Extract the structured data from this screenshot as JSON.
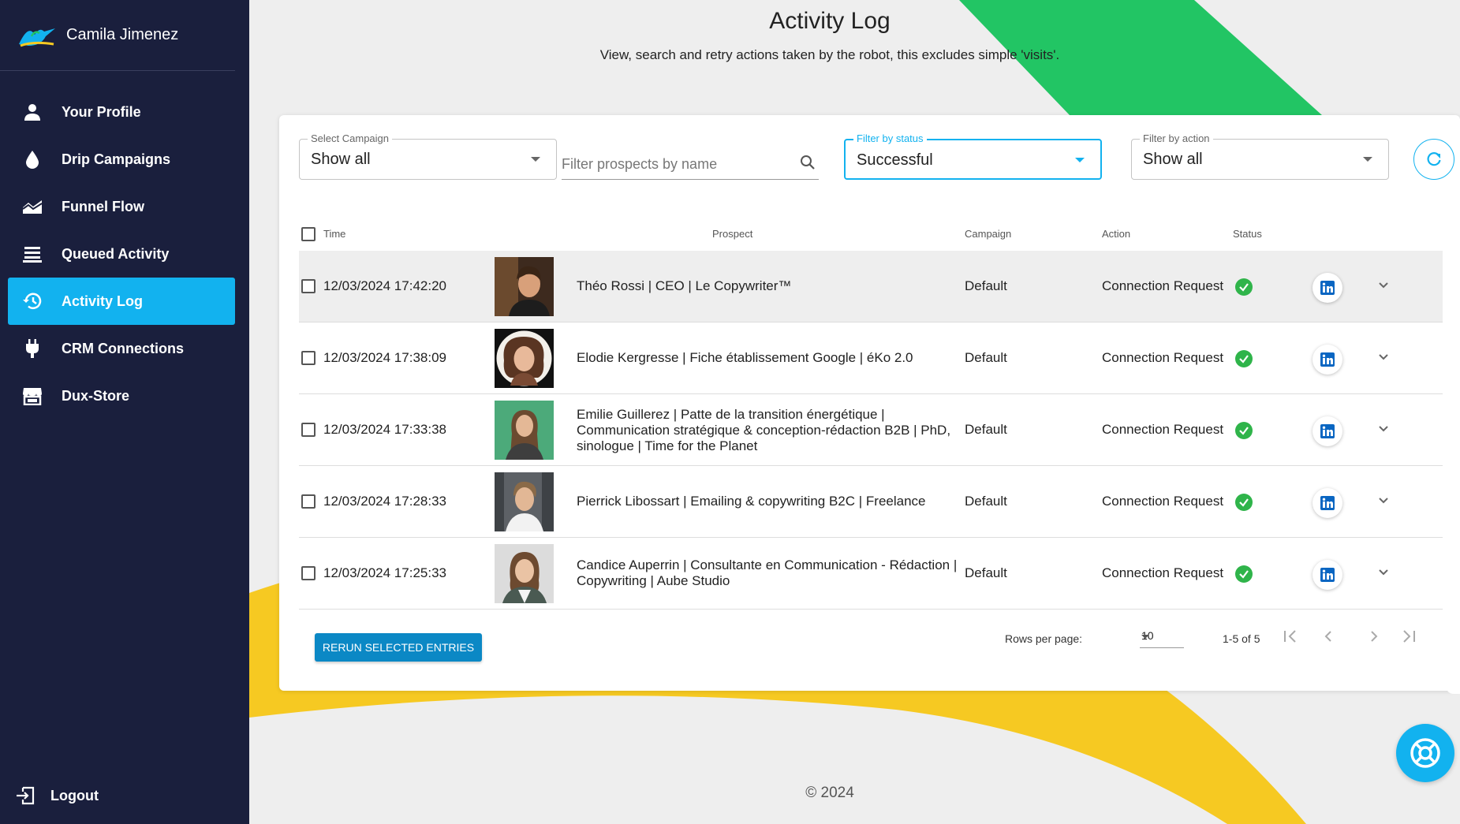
{
  "user": {
    "name": "Camila Jimenez"
  },
  "sidebar": {
    "items": [
      {
        "label": "Your Profile",
        "icon": "person-icon"
      },
      {
        "label": "Drip Campaigns",
        "icon": "drop-icon"
      },
      {
        "label": "Funnel Flow",
        "icon": "area-chart-icon"
      },
      {
        "label": "Queued Activity",
        "icon": "queue-icon"
      },
      {
        "label": "Activity Log",
        "icon": "history-icon",
        "active": true
      },
      {
        "label": "CRM Connections",
        "icon": "plug-icon"
      },
      {
        "label": "Dux-Store",
        "icon": "store-icon"
      }
    ],
    "logout": "Logout"
  },
  "page": {
    "title": "Activity Log",
    "subtitle": "View, search and retry actions taken by the robot, this excludes simple 'visits'.",
    "copyright": "© 2024"
  },
  "filters": {
    "campaign": {
      "label": "Select Campaign",
      "value": "Show all"
    },
    "search": {
      "placeholder": "Filter prospects by name"
    },
    "status": {
      "label": "Filter by status",
      "value": "Successful"
    },
    "action": {
      "label": "Filter by action",
      "value": "Show all"
    }
  },
  "table": {
    "headers": {
      "time": "Time",
      "prospect": "Prospect",
      "campaign": "Campaign",
      "action": "Action",
      "status": "Status"
    },
    "rows": [
      {
        "time": "12/03/2024 17:42:20",
        "prospect": "Théo Rossi | CEO  | Le Copywriter™",
        "campaign": "Default",
        "action": "Connection Request"
      },
      {
        "time": "12/03/2024 17:38:09",
        "prospect": "Elodie Kergresse | Fiche établissement Google  | éKo 2.0",
        "campaign": "Default",
        "action": "Connection Request"
      },
      {
        "time": "12/03/2024 17:33:38",
        "prospect": "Emilie Guillerez | Patte de la transition énergétique | Communication stratégique & conception-rédaction B2B | PhD, sinologue  | Time for the Planet",
        "campaign": "Default",
        "action": "Connection Request"
      },
      {
        "time": "12/03/2024 17:28:33",
        "prospect": "Pierrick Libossart | Emailing & copywriting B2C  | Freelance",
        "campaign": "Default",
        "action": "Connection Request"
      },
      {
        "time": "12/03/2024 17:25:33",
        "prospect": "Candice Auperrin | Consultante en Communication - Rédaction | Copywriting  | Aube Studio",
        "campaign": "Default",
        "action": "Connection Request"
      }
    ]
  },
  "footer": {
    "rerun_label": "RERUN SELECTED ENTRIES",
    "rows_per_page_label": "Rows per page:",
    "rows_per_page": "10",
    "range": "1-5 of 5"
  },
  "colors": {
    "sidebar": "#1a1f3d",
    "accent": "#12b2ef",
    "success": "#2fb44a",
    "green_shape": "#22c564",
    "yellow_shape": "#f6c922"
  }
}
